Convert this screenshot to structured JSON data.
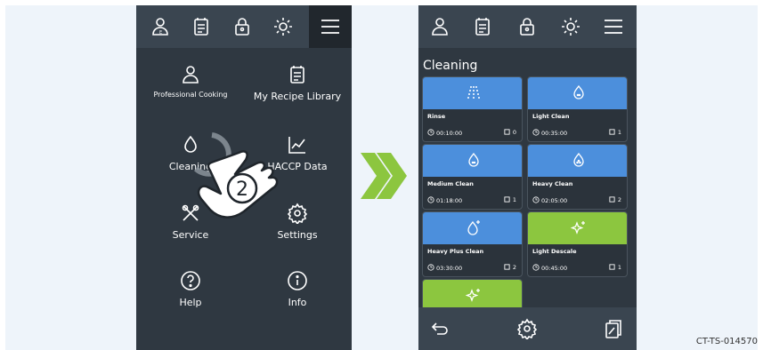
{
  "left_screen": {
    "menu": [
      {
        "label": "Professional Cooking",
        "icon": "chef-icon"
      },
      {
        "label": "My Recipe Library",
        "icon": "recipe-book-icon"
      },
      {
        "label": "Cleaning",
        "icon": "water-drop-icon"
      },
      {
        "label": "HACCP Data",
        "icon": "chart-icon"
      },
      {
        "label": "Service",
        "icon": "tools-icon"
      },
      {
        "label": "Settings",
        "icon": "gear-icon"
      },
      {
        "label": "Help",
        "icon": "help-icon"
      },
      {
        "label": "Info",
        "icon": "info-icon"
      }
    ],
    "step_badge": "2"
  },
  "right_screen": {
    "title": "Cleaning",
    "programs": [
      {
        "name": "Rinse",
        "time": "00:10:00",
        "count": "0",
        "color": "#4c8fdc",
        "icon": "rinse-icon"
      },
      {
        "name": "Light Clean",
        "time": "00:35:00",
        "count": "1",
        "color": "#4c8fdc",
        "icon": "drop-icon"
      },
      {
        "name": "Medium Clean",
        "time": "01:18:00",
        "count": "1",
        "color": "#4c8fdc",
        "icon": "drop-icon"
      },
      {
        "name": "Heavy Clean",
        "time": "02:05:00",
        "count": "2",
        "color": "#4c8fdc",
        "icon": "drop-icon"
      },
      {
        "name": "Heavy Plus Clean",
        "time": "03:30:00",
        "count": "2",
        "color": "#4c8fdc",
        "icon": "drop-plus-icon"
      },
      {
        "name": "Light Descale",
        "time": "00:45:00",
        "count": "1",
        "color": "#8cc63f",
        "icon": "sparkle-icon"
      }
    ]
  },
  "footer_code": "CT-TS-014570"
}
